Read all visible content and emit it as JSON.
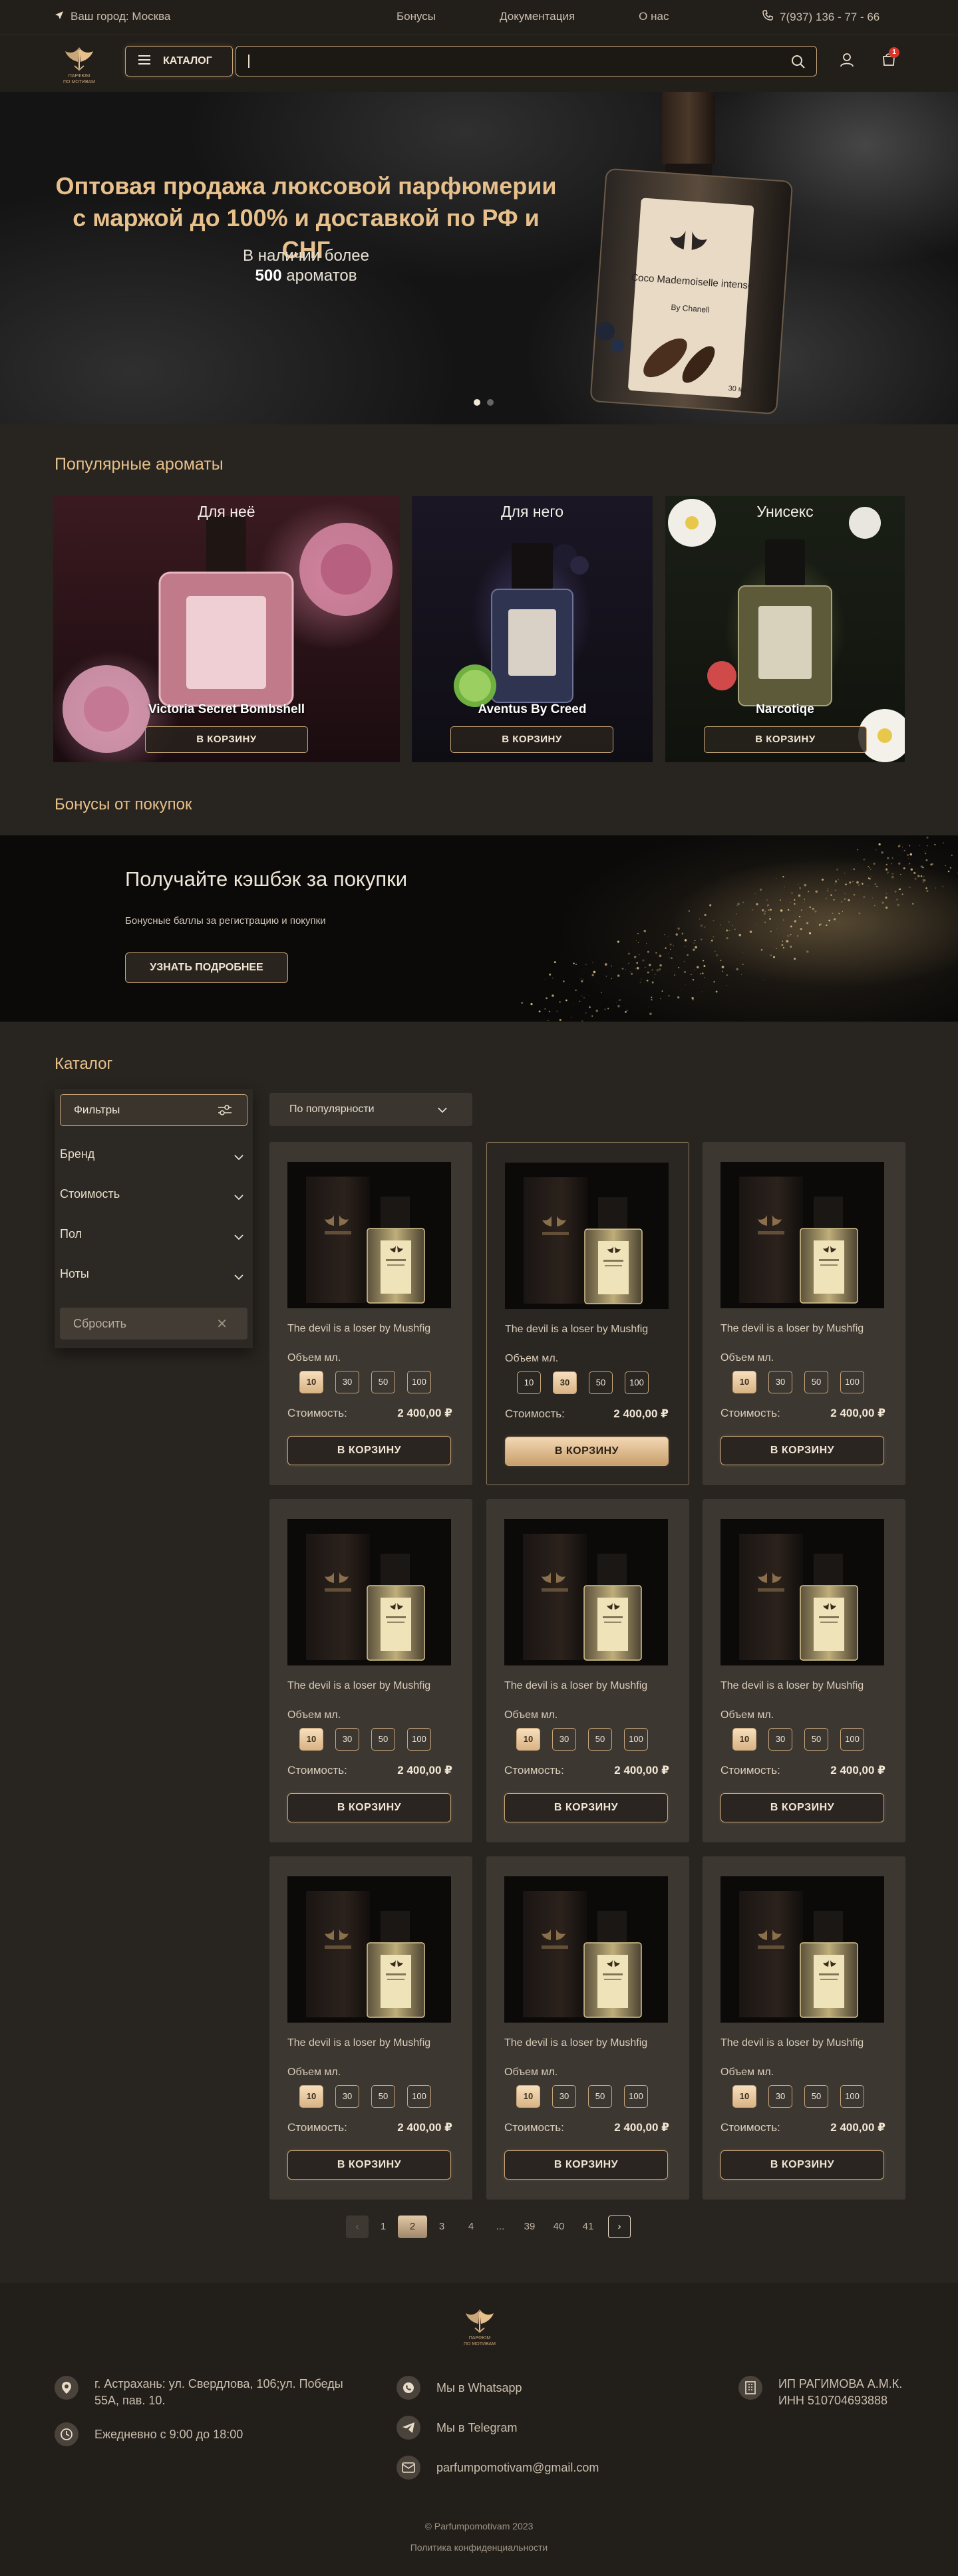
{
  "topbar": {
    "city": "Ваш город: Москва",
    "links": [
      "Бонусы",
      "Документация",
      "О нас"
    ],
    "phone": "7(937) 136 - 77 - 66"
  },
  "header": {
    "logo_text": "ПАРФЮМ ПО МОТИВАМ",
    "catalog_label": "КАТАЛОГ",
    "search_value": "",
    "cart_count": "1"
  },
  "hero": {
    "title_line1": "Оптовая продажа люксовой парфюмерии",
    "title_line2": "с маржой до 100% и доставкой по РФ и СНГ",
    "sub_line1": "В наличии более",
    "sub_bold": "500",
    "sub_rest": " ароматов",
    "bottle_label": "Coco Mademoiselle intense",
    "bottle_small": "By Chanell",
    "bottle_volume": "30 мл"
  },
  "popular": {
    "title": "Популярные ароматы",
    "cards": [
      {
        "label": "Для неё",
        "name": "Victoria Secret Bombshell",
        "button": "В КОРЗИНУ"
      },
      {
        "label": "Для него",
        "name": "Aventus By Creed",
        "button": "В КОРЗИНУ"
      },
      {
        "label": "Унисекс",
        "name": "Narcotiqe",
        "button": "В КОРЗИНУ"
      }
    ]
  },
  "bonus": {
    "section_title": "Бонусы от покупок",
    "heading": "Получайте кэшбэк за покупки",
    "text": "Бонусные баллы за регистрацию и покупки",
    "button": "УЗНАТЬ ПОДРОБНЕЕ"
  },
  "catalog": {
    "title": "Каталог",
    "filters": {
      "header": "Фильтры",
      "rows": [
        "Бренд",
        "Стоимость",
        "Пол",
        "Ноты"
      ],
      "reset": "Сбросить"
    },
    "sort": "По популярности",
    "products": [
      {
        "name": "The devil is a loser by Mushfig",
        "volume_label": "Объем мл.",
        "sizes": [
          "10",
          "30",
          "50",
          "100"
        ],
        "selected": "10",
        "cost_label": "Стоимость:",
        "price": "2 400,00 ₽",
        "button": "В КОРЗИНУ"
      },
      {
        "name": "The devil is a loser by Mushfig",
        "volume_label": "Объем мл.",
        "sizes": [
          "10",
          "30",
          "50",
          "100"
        ],
        "selected": "30",
        "cost_label": "Стоимость:",
        "price": "2 400,00 ₽",
        "button": "В КОРЗИНУ"
      },
      {
        "name": "The devil is a loser by Mushfig",
        "volume_label": "Объем мл.",
        "sizes": [
          "10",
          "30",
          "50",
          "100"
        ],
        "selected": "10",
        "cost_label": "Стоимость:",
        "price": "2 400,00 ₽",
        "button": "В КОРЗИНУ"
      },
      {
        "name": "The devil is a loser by Mushfig",
        "volume_label": "Объем мл.",
        "sizes": [
          "10",
          "30",
          "50",
          "100"
        ],
        "selected": "10",
        "cost_label": "Стоимость:",
        "price": "2 400,00 ₽",
        "button": "В КОРЗИНУ"
      },
      {
        "name": "The devil is a loser by Mushfig",
        "volume_label": "Объем мл.",
        "sizes": [
          "10",
          "30",
          "50",
          "100"
        ],
        "selected": "10",
        "cost_label": "Стоимость:",
        "price": "2 400,00 ₽",
        "button": "В КОРЗИНУ"
      },
      {
        "name": "The devil is a loser by Mushfig",
        "volume_label": "Объем мл.",
        "sizes": [
          "10",
          "30",
          "50",
          "100"
        ],
        "selected": "10",
        "cost_label": "Стоимость:",
        "price": "2 400,00 ₽",
        "button": "В КОРЗИНУ"
      },
      {
        "name": "The devil is a loser by Mushfig",
        "volume_label": "Объем мл.",
        "sizes": [
          "10",
          "30",
          "50",
          "100"
        ],
        "selected": "10",
        "cost_label": "Стоимость:",
        "price": "2 400,00 ₽",
        "button": "В КОРЗИНУ"
      },
      {
        "name": "The devil is a loser by Mushfig",
        "volume_label": "Объем мл.",
        "sizes": [
          "10",
          "30",
          "50",
          "100"
        ],
        "selected": "10",
        "cost_label": "Стоимость:",
        "price": "2 400,00 ₽",
        "button": "В КОРЗИНУ"
      },
      {
        "name": "The devil is a loser by Mushfig",
        "volume_label": "Объем мл.",
        "sizes": [
          "10",
          "30",
          "50",
          "100"
        ],
        "selected": "10",
        "cost_label": "Стоимость:",
        "price": "2 400,00 ₽",
        "button": "В КОРЗИНУ"
      }
    ],
    "active_index": 1,
    "pagination": {
      "prev": "‹",
      "pages": [
        "1",
        "2",
        "3",
        "4",
        "...",
        "39",
        "40",
        "41"
      ],
      "current": "2",
      "next": "›"
    }
  },
  "footer": {
    "address": "г. Астрахань: ул. Свердлова, 106;ул. Победы 55А, пав. 10.",
    "hours": "Ежедневно с 9:00 до 18:00",
    "whatsapp": "Мы в Whatsapp",
    "telegram": "Мы в Telegram",
    "email": "parfumpomotivam@gmail.com",
    "company_line1": "ИП РАГИМОВА А.М.К.",
    "company_line2": "ИНН 510704693888",
    "copyright": "© Parfumpomotivam 2023",
    "policy": "Политика конфиденциальности"
  },
  "colors": {
    "accent_gold": "#e7c08c",
    "border_gold": "#c9a679",
    "background": "#28241f",
    "header_bg": "#221e1a",
    "badge_red": "#d8352b"
  }
}
